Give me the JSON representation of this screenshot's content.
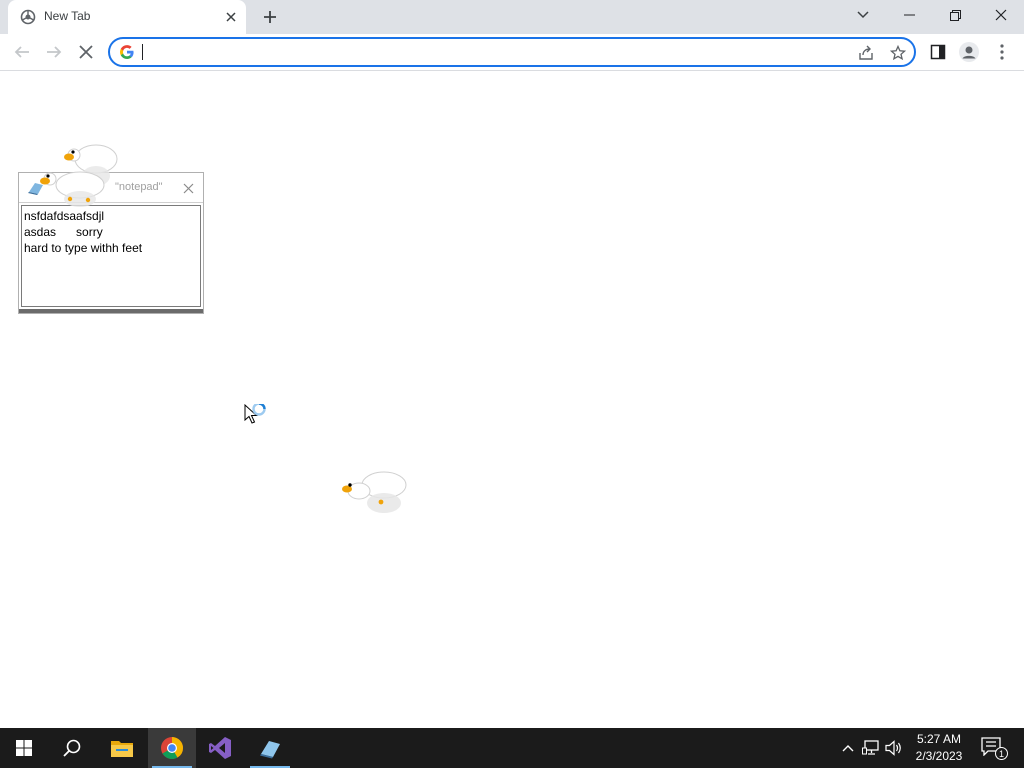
{
  "browser": {
    "tab": {
      "title": "New Tab"
    },
    "omnibox": {
      "value": "",
      "placeholder": ""
    }
  },
  "notepad": {
    "title": "\"notepad\"",
    "lines": [
      "nsfdafdsaafsdjl",
      "asdas      sorry",
      "hard to type withh feet"
    ],
    "text": "nsfdafdsaafsdjl\nasdas      sorry\nhard to type withh feet"
  },
  "taskbar": {
    "clock": {
      "time": "5:27 AM",
      "date": "2/3/2023"
    },
    "notification_count": "1"
  },
  "colors": {
    "accent": "#1a73e8",
    "tab_strip": "#dee1e6",
    "taskbar": "#1b1b1b",
    "goose_beak": "#f0a30a"
  }
}
